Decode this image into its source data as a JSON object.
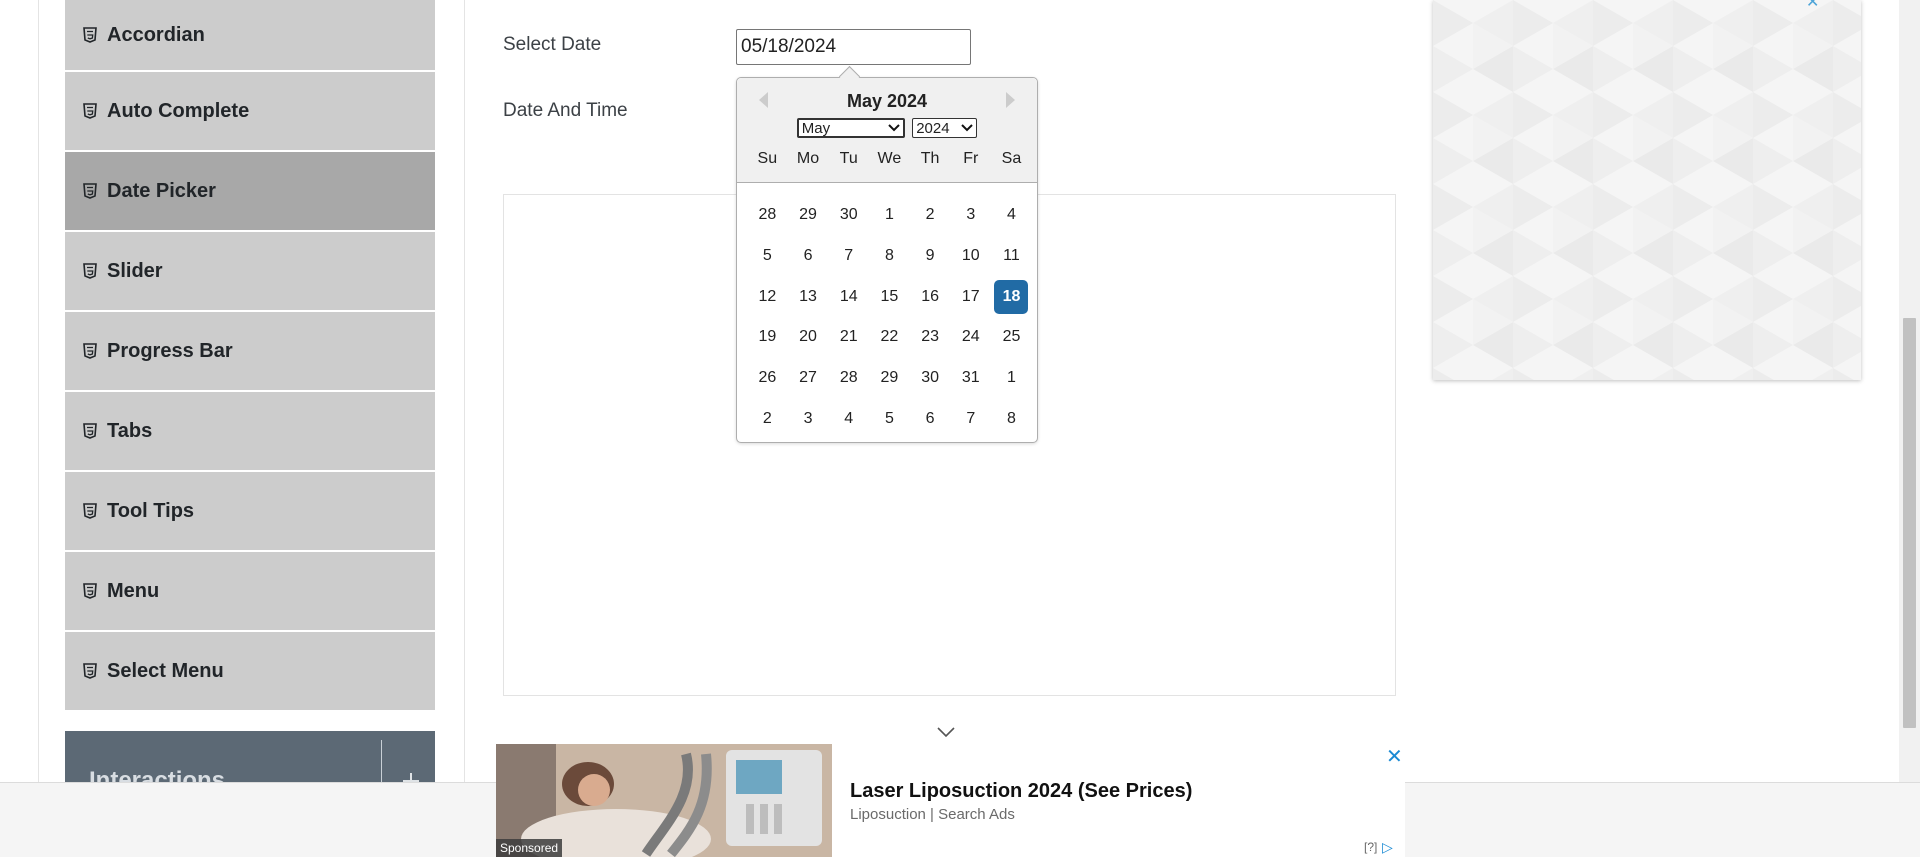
{
  "sidebar": {
    "items": [
      {
        "label": "Accordian",
        "active": false
      },
      {
        "label": "Auto Complete",
        "active": false
      },
      {
        "label": "Date Picker",
        "active": true
      },
      {
        "label": "Slider",
        "active": false
      },
      {
        "label": "Progress Bar",
        "active": false
      },
      {
        "label": "Tabs",
        "active": false
      },
      {
        "label": "Tool Tips",
        "active": false
      },
      {
        "label": "Menu",
        "active": false
      },
      {
        "label": "Select Menu",
        "active": false
      }
    ],
    "group": {
      "title": "Interactions",
      "icon": "plus-icon"
    }
  },
  "form": {
    "select_date_label": "Select Date",
    "select_date_value": "05/18/2024",
    "date_time_label": "Date And Time"
  },
  "datepicker": {
    "title": "May 2024",
    "month_select": "May",
    "year_select": "2024",
    "prev_icon": "triangle-left-icon",
    "next_icon": "triangle-right-icon",
    "days_of_week": [
      "Su",
      "Mo",
      "Tu",
      "We",
      "Th",
      "Fr",
      "Sa"
    ],
    "weeks": [
      [
        "28",
        "29",
        "30",
        "1",
        "2",
        "3",
        "4"
      ],
      [
        "5",
        "6",
        "7",
        "8",
        "9",
        "10",
        "11"
      ],
      [
        "12",
        "13",
        "14",
        "15",
        "16",
        "17",
        "18"
      ],
      [
        "19",
        "20",
        "21",
        "22",
        "23",
        "24",
        "25"
      ],
      [
        "26",
        "27",
        "28",
        "29",
        "30",
        "31",
        "1"
      ],
      [
        "2",
        "3",
        "4",
        "5",
        "6",
        "7",
        "8"
      ]
    ],
    "selected_day": "18",
    "selected_color": "#216ba5"
  },
  "bottom_ad": {
    "sponsored_label": "Sponsored",
    "headline": "Laser Liposuction 2024 (See Prices)",
    "source": "Liposuction | Search Ads",
    "help_label": "[?]",
    "close_icon": "close-icon",
    "adchoices_icon": "adchoices-icon"
  },
  "colors": {
    "sidebar_item": "#cccccc",
    "sidebar_item_active": "#a8a8a8",
    "group_header": "#5c6975",
    "accent": "#1a8ad4"
  }
}
